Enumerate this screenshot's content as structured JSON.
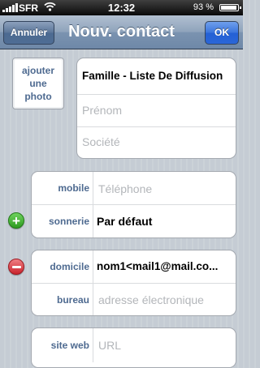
{
  "status_bar": {
    "carrier": "SFR",
    "time": "12:32",
    "battery_percent": "93 %",
    "battery_level": 0.93,
    "signal_icon": "signal-bars-icon",
    "wifi_icon": "wifi-icon",
    "battery_icon": "battery-icon"
  },
  "nav": {
    "title": "Nouv. contact",
    "cancel_label": "Annuler",
    "ok_label": "OK"
  },
  "photo": {
    "label_line1": "ajouter",
    "label_line2": "une",
    "label_line3": "photo"
  },
  "name_group": {
    "last_name_value": "Famille - Liste De Diffusion",
    "first_name_placeholder": "Prénom",
    "company_placeholder": "Société"
  },
  "phone_group": {
    "mobile_label": "mobile",
    "phone_placeholder": "Téléphone",
    "ringtone_label": "sonnerie",
    "ringtone_value": "Par défaut",
    "add_icon": "plus-icon"
  },
  "email_group": {
    "home_label": "domicile",
    "home_value": "nom1<mail1@mail.co...",
    "work_label": "bureau",
    "email_placeholder": "adresse électronique",
    "remove_icon": "minus-icon"
  },
  "web_group": {
    "label": "site web",
    "url_placeholder": "URL"
  },
  "colors": {
    "nav_bar": "#7b93b0",
    "ok_button": "#2a66d8",
    "label_blue": "#4e6a90",
    "add_green": "#2e9a20",
    "remove_red": "#c9232c"
  }
}
